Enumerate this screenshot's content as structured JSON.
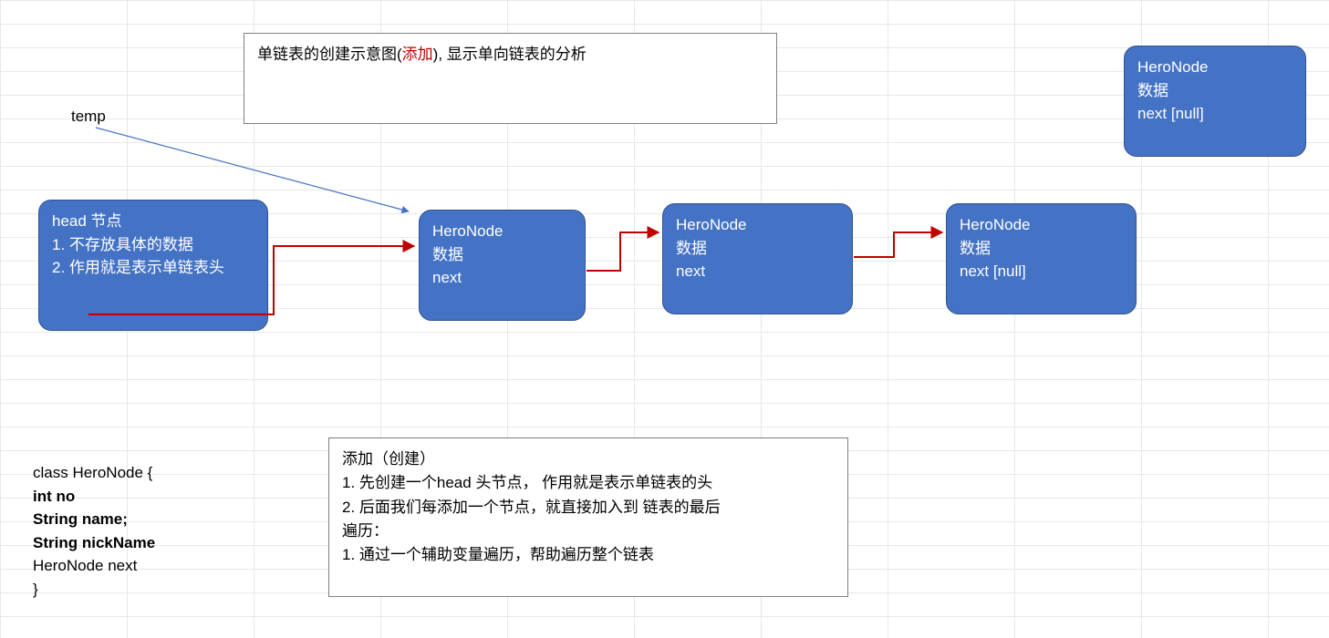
{
  "title_box": {
    "pre": "单链表的创建示意图(",
    "highlight": "添加",
    "post": "), 显示单向链表的分析"
  },
  "temp_label": "temp",
  "nodes": {
    "head": {
      "l1": "head 节点",
      "l2": "1. 不存放具体的数据",
      "l3": "2. 作用就是表示单链表头"
    },
    "n1": {
      "l1": "HeroNode",
      "l2": "数据",
      "l3": "next"
    },
    "n2": {
      "l1": "HeroNode",
      "l2": "数据",
      "l3": "next"
    },
    "n3": {
      "l1": "HeroNode",
      "l2": "数据",
      "l3": "next [null]"
    },
    "floating": {
      "l1": "HeroNode",
      "l2": "数据",
      "l3": "next [null]"
    }
  },
  "class_code": {
    "l1": "class HeroNode {",
    "l2": " int no",
    "l3": " String name;",
    "l4": " String nickName",
    "l5": " HeroNode next",
    "l6": "}"
  },
  "algo_box": {
    "l1": "添加（创建）",
    "l2": "1. 先创建一个head 头节点， 作用就是表示单链表的头",
    "l3": "2. 后面我们每添加一个节点，就直接加入到  链表的最后",
    "l4": "遍历：",
    "l5": "1.  通过一个辅助变量遍历，帮助遍历整个链表"
  }
}
